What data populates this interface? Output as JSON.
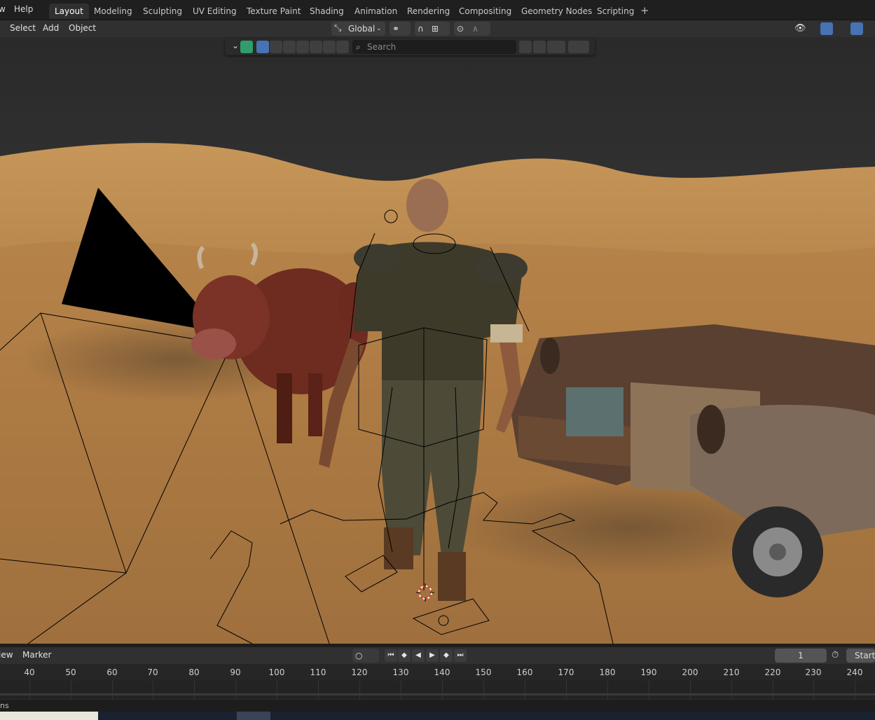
{
  "topbar": {
    "menu": [
      {
        "label": "w"
      },
      {
        "label": "Help"
      }
    ],
    "workspaces": [
      {
        "label": "Layout",
        "active": true
      },
      {
        "label": "Modeling"
      },
      {
        "label": "Sculpting"
      },
      {
        "label": "UV Editing"
      },
      {
        "label": "Texture Paint"
      },
      {
        "label": "Shading"
      },
      {
        "label": "Animation"
      },
      {
        "label": "Rendering"
      },
      {
        "label": "Compositing"
      },
      {
        "label": "Geometry Nodes"
      },
      {
        "label": "Scripting"
      }
    ],
    "add_workspace_icon": "plus-icon"
  },
  "viewport_header": {
    "menu": [
      {
        "label": "Select"
      },
      {
        "label": "Add"
      },
      {
        "label": "Object"
      }
    ],
    "transform_orientation": "Global",
    "accent": "#4772b3"
  },
  "outliner_toolbar": {
    "search_placeholder": "Search"
  },
  "timeline": {
    "menu": [
      {
        "label": "iew"
      },
      {
        "label": "Marker"
      }
    ],
    "current_frame": "1",
    "start_label": "Start",
    "ruler_ticks": [
      "40",
      "50",
      "60",
      "70",
      "80",
      "90",
      "100",
      "110",
      "120",
      "130",
      "140",
      "150",
      "160",
      "170",
      "180",
      "190",
      "200",
      "210",
      "220",
      "230",
      "240"
    ]
  },
  "status": {
    "text": "ns"
  },
  "colors": {
    "sand": "#b8844d",
    "sky_top": "#2b2b2b",
    "active_blue": "#4772b3"
  }
}
